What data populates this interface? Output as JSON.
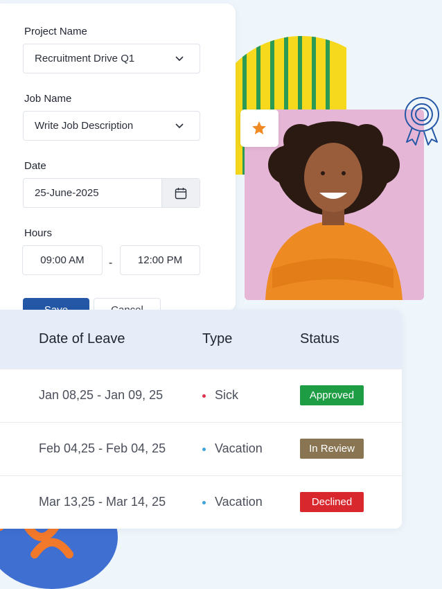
{
  "form": {
    "project_label": "Project Name",
    "project_value": "Recruitment Drive Q1",
    "job_label": "Job Name",
    "job_value": "Write Job Description",
    "date_label": "Date",
    "date_value": "25-June-2025",
    "hours_label": "Hours",
    "start_time": "09:00 AM",
    "separator": "-",
    "end_time": "12:00 PM",
    "save_label": "Save",
    "cancel_label": "Cancel"
  },
  "leave_table": {
    "headers": [
      "Date of Leave",
      "Type",
      "Status"
    ],
    "rows": [
      {
        "date": "Jan 08,25 - Jan 09, 25",
        "type": "Sick",
        "status": "Approved",
        "status_color": "#1f9d45",
        "dot_color": "#e0304d"
      },
      {
        "date": "Feb 04,25 - Feb 04, 25",
        "type": "Vacation",
        "status": "In Review",
        "status_color": "#8a7552",
        "dot_color": "#3ea3d8"
      },
      {
        "date": "Mar 13,25 - Mar 14, 25",
        "type": "Vacation",
        "status": "Declined",
        "status_color": "#d9272e",
        "dot_color": "#3ea3d8"
      }
    ]
  },
  "icons": {
    "project_dropdown": "chevron-down-icon",
    "job_dropdown": "chevron-down-icon",
    "date_picker": "calendar-icon",
    "badge": "star-icon",
    "decor": "award-ribbon-icon"
  },
  "colors": {
    "primary": "#2457a6",
    "header_bg": "#e6edf8"
  }
}
